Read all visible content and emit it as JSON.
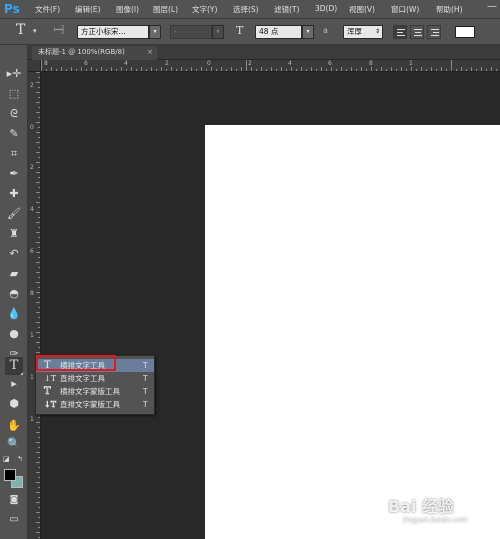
{
  "app": {
    "logo": "Ps",
    "menu": [
      "文件(F)",
      "编辑(E)",
      "图像(I)",
      "图层(L)",
      "文字(Y)",
      "选择(S)",
      "滤镜(T)",
      "3D(D)",
      "视图(V)",
      "窗口(W)",
      "帮助(H)"
    ],
    "window_control": "—"
  },
  "options": {
    "tool_glyph": "T",
    "tool_arrow": "▾",
    "font_family": "方正小标宋...",
    "font_style": "-",
    "size_glyph": "T",
    "font_size": "48 点",
    "aa_glyph": "a",
    "antialias": "浑厚",
    "align": [
      "left",
      "center",
      "right"
    ],
    "text_color": "#ffffff"
  },
  "document": {
    "tab_title": "未标题-1 @ 100%(RGB/8)",
    "tab_close": "×"
  },
  "rulers": {
    "horizontal": [
      "8",
      "6",
      "4",
      "2",
      "0",
      "2",
      "4",
      "6",
      "8",
      "1"
    ],
    "vertical": [
      "2",
      "0",
      "2",
      "4",
      "6",
      "8",
      "1",
      "1",
      "1"
    ]
  },
  "tools": [
    {
      "name": "move-tool",
      "glyph": "▸✛"
    },
    {
      "name": "marquee-tool",
      "glyph": "⬚"
    },
    {
      "name": "lasso-tool",
      "glyph": "ᘓ"
    },
    {
      "name": "quick-select-tool",
      "glyph": "✎"
    },
    {
      "name": "crop-tool",
      "glyph": "⌗"
    },
    {
      "name": "eyedropper-tool",
      "glyph": "✒"
    },
    {
      "name": "healing-tool",
      "glyph": "✚"
    },
    {
      "name": "brush-tool",
      "glyph": "🖌"
    },
    {
      "name": "clone-stamp-tool",
      "glyph": "♜"
    },
    {
      "name": "history-brush-tool",
      "glyph": "↶"
    },
    {
      "name": "eraser-tool",
      "glyph": "▰"
    },
    {
      "name": "paint-bucket-tool",
      "glyph": "◓"
    },
    {
      "name": "blur-tool",
      "glyph": "💧"
    },
    {
      "name": "dodge-tool",
      "glyph": "●"
    },
    {
      "name": "pen-tool",
      "glyph": "✑"
    },
    {
      "name": "type-tool",
      "glyph": "T"
    },
    {
      "name": "path-select-tool",
      "glyph": "▸"
    },
    {
      "name": "shape-tool",
      "glyph": "⬢"
    },
    {
      "name": "hand-tool",
      "glyph": "✋"
    },
    {
      "name": "zoom-tool",
      "glyph": "🔍"
    },
    {
      "name": "quick-mask-tool",
      "glyph": "◙"
    },
    {
      "name": "screen-mode-tool",
      "glyph": "▭"
    }
  ],
  "colors": {
    "foreground": "#000000",
    "background": "#7fb3ad",
    "swap_glyph": "↰",
    "default_glyph": "◪"
  },
  "type_flyout": [
    {
      "glyph": "T",
      "label": "横排文字工具",
      "key": "T",
      "selected": true
    },
    {
      "glyph": "↓T",
      "label": "直排文字工具",
      "key": "T",
      "selected": false
    },
    {
      "glyph": "T",
      "label": "横排文字蒙版工具",
      "key": "T",
      "selected": false
    },
    {
      "glyph": "↓T",
      "label": "直排文字蒙版工具",
      "key": "T",
      "selected": false
    }
  ],
  "watermark": {
    "brand": "Bai 经验",
    "url": "jingyan.baidu.com"
  }
}
